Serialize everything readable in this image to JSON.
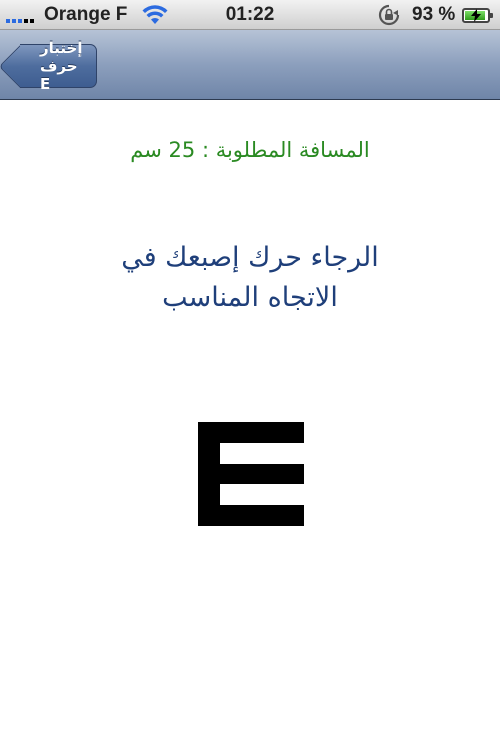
{
  "status_bar": {
    "carrier": "Orange F",
    "time": "01:22",
    "battery_percent": "93 %",
    "battery_level": 0.93,
    "icons": [
      "signal-icon",
      "wifi-icon",
      "rotation-lock-icon",
      "battery-charging-icon"
    ]
  },
  "nav_bar": {
    "back_label": "إختبار حرف E"
  },
  "content": {
    "distance": "المسافة المطلوبة : 25  سم",
    "instruction": "الرجاء حرك إصبعك في الاتجاه المناسب",
    "optotype": "E",
    "optotype_direction": "right"
  },
  "colors": {
    "distance_text": "#2a8a22",
    "instruction_text": "#1f3f7a",
    "optotype": "#000000",
    "nav_bar": "#8c9fbd"
  }
}
